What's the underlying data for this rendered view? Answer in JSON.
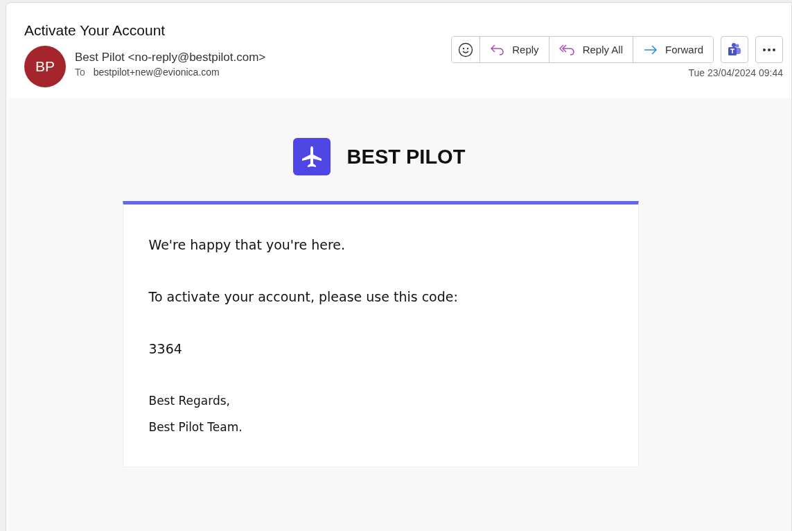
{
  "subject": "Activate Your Account",
  "sender": {
    "initials": "BP",
    "name": "Best Pilot <no-reply@bestpilot.com>",
    "to_label": "To",
    "to": "bestpilot+new@evionica.com"
  },
  "actions": [
    {
      "kind": "emoji"
    },
    {
      "kind": "reply",
      "label": "Reply"
    },
    {
      "kind": "reply_all",
      "label": "Reply All"
    },
    {
      "kind": "forward",
      "label": "Forward"
    }
  ],
  "date": "Tue 23/04/2024 09:44",
  "brand": "BEST PILOT",
  "body": {
    "paragraphs": [
      "We're happy that you're here.",
      "To activate your account, please use this code:",
      "3364"
    ],
    "closing": [
      "Best Regards,",
      "Best Pilot Team."
    ]
  }
}
